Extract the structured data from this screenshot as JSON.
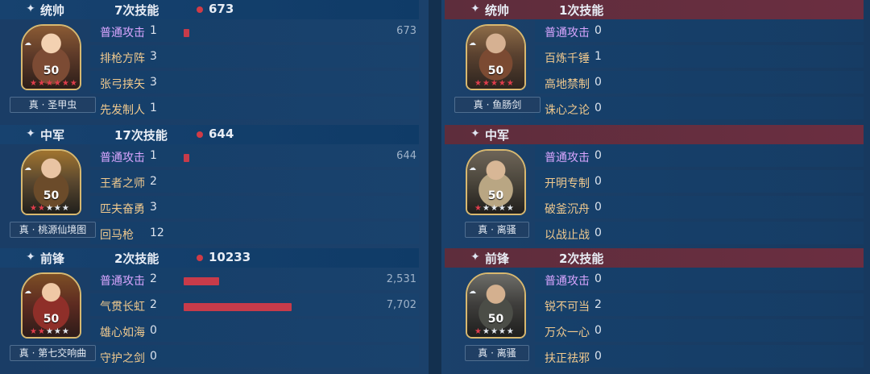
{
  "colors": {
    "accent_red": "#c73b4a",
    "left_header": "#17426f",
    "right_header": "#6b2e41",
    "skill_first": "#d9a6ff",
    "skill_normal": "#f0c98e"
  },
  "left": [
    {
      "role": "统帅",
      "role_icon": "✦",
      "times": "7次技能",
      "damage": "673",
      "level": "50",
      "stars_red": 6,
      "stars_white": 0,
      "hero_name": "真 · 圣甲虫",
      "skills": [
        {
          "name": "普通攻击",
          "count": "1",
          "bar": 0.05,
          "total": "673"
        },
        {
          "name": "排枪方阵",
          "count": "3"
        },
        {
          "name": "张弓挟矢",
          "count": "3"
        },
        {
          "name": "先发制人",
          "count": "1"
        }
      ]
    },
    {
      "role": "中军",
      "role_icon": "✦",
      "times": "17次技能",
      "damage": "644",
      "level": "50",
      "stars_red": 2,
      "stars_white": 3,
      "hero_name": "真 · 桃源仙境图",
      "skills": [
        {
          "name": "普通攻击",
          "count": "1",
          "bar": 0.05,
          "total": "644"
        },
        {
          "name": "王者之师",
          "count": "2"
        },
        {
          "name": "匹夫奋勇",
          "count": "3"
        },
        {
          "name": "回马枪",
          "count": "12"
        }
      ]
    },
    {
      "role": "前锋",
      "role_icon": "✦",
      "times": "2次技能",
      "damage": "10233",
      "level": "50",
      "stars_red": 2,
      "stars_white": 3,
      "hero_name": "真 · 第七交响曲",
      "skills": [
        {
          "name": "普通攻击",
          "count": "2",
          "bar": 0.33,
          "total": "2,531"
        },
        {
          "name": "气贯长虹",
          "count": "2",
          "bar": 1.0,
          "total": "7,702"
        },
        {
          "name": "雄心如海",
          "count": "0"
        },
        {
          "name": "守护之剑",
          "count": "0"
        }
      ]
    }
  ],
  "right": [
    {
      "role": "统帅",
      "role_icon": "✦",
      "times": "1次技能",
      "damage": "",
      "level": "50",
      "stars_red": 5,
      "stars_white": 0,
      "hero_name": "真 · 鱼肠剑",
      "skills": [
        {
          "name": "普通攻击",
          "count": "0"
        },
        {
          "name": "百炼千锤",
          "count": "1"
        },
        {
          "name": "高地禁制",
          "count": "0"
        },
        {
          "name": "诛心之论",
          "count": "0"
        }
      ]
    },
    {
      "role": "中军",
      "role_icon": "✦",
      "times": "",
      "damage": "",
      "level": "50",
      "stars_red": 1,
      "stars_white": 4,
      "hero_name": "真 · 离骚",
      "skills": [
        {
          "name": "普通攻击",
          "count": "0"
        },
        {
          "name": "开明专制",
          "count": "0"
        },
        {
          "name": "破釜沉舟",
          "count": "0"
        },
        {
          "name": "以战止战",
          "count": "0"
        }
      ]
    },
    {
      "role": "前锋",
      "role_icon": "✦",
      "times": "2次技能",
      "damage": "",
      "level": "50",
      "stars_red": 1,
      "stars_white": 4,
      "hero_name": "真 · 离骚",
      "skills": [
        {
          "name": "普通攻击",
          "count": "0"
        },
        {
          "name": "锐不可当",
          "count": "2"
        },
        {
          "name": "万众一心",
          "count": "0"
        },
        {
          "name": "扶正祛邪",
          "count": "0"
        }
      ]
    }
  ]
}
